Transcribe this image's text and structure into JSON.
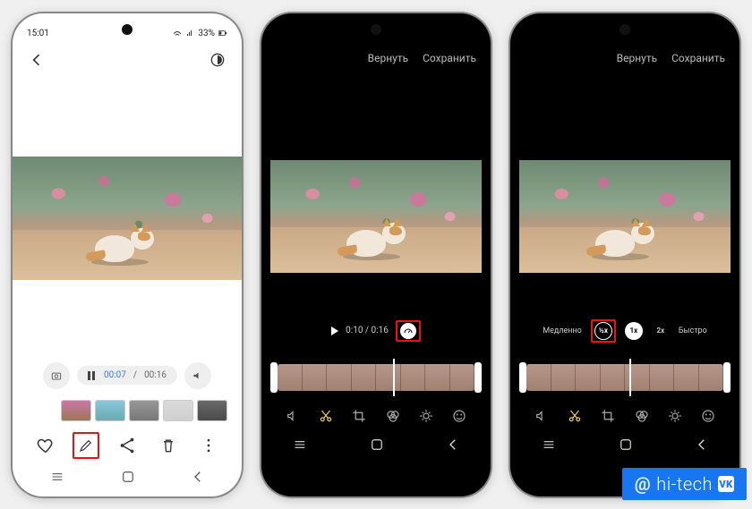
{
  "phone1": {
    "status": {
      "time": "15:01",
      "battery": "33%"
    },
    "scrubber": {
      "current": "00:07",
      "total": "00:16"
    },
    "actions": {
      "favorite": "heart-icon",
      "edit": "pencil-icon",
      "share": "share-icon",
      "delete": "trash-icon",
      "more": "more-icon"
    }
  },
  "phone2": {
    "header": {
      "revert": "Вернуть",
      "save": "Сохранить"
    },
    "playback": {
      "current": "0:10",
      "total": "0:16"
    }
  },
  "phone3": {
    "header": {
      "revert": "Вернуть",
      "save": "Сохранить"
    },
    "speed": {
      "slow_label": "Медленно",
      "fast_label": "Быстро",
      "half": "½x",
      "one": "1x",
      "two": "2x"
    }
  },
  "watermark": {
    "at": "@",
    "brand": "hi-tech"
  }
}
